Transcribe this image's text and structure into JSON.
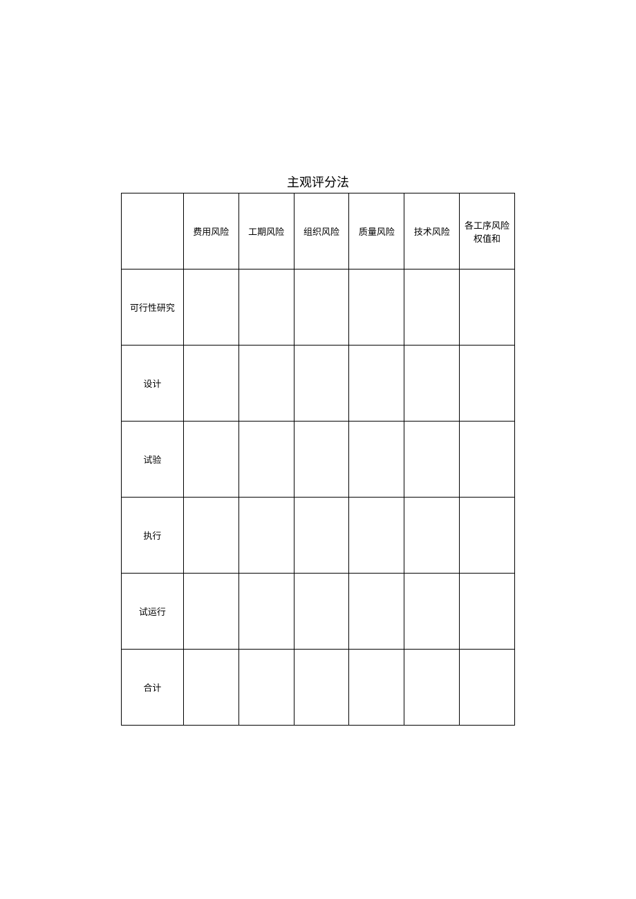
{
  "title": "主观评分法",
  "table": {
    "columnHeaders": [
      "费用风险",
      "工期风险",
      "组织风险",
      "质量风险",
      "技术风险",
      "各工序风险权值和"
    ],
    "rowHeaders": [
      "可行性研究",
      "设计",
      "试验",
      "执行",
      "试运行",
      "合计"
    ],
    "cells": [
      [
        "",
        "",
        "",
        "",
        "",
        ""
      ],
      [
        "",
        "",
        "",
        "",
        "",
        ""
      ],
      [
        "",
        "",
        "",
        "",
        "",
        ""
      ],
      [
        "",
        "",
        "",
        "",
        "",
        ""
      ],
      [
        "",
        "",
        "",
        "",
        "",
        ""
      ],
      [
        "",
        "",
        "",
        "",
        "",
        ""
      ]
    ]
  }
}
